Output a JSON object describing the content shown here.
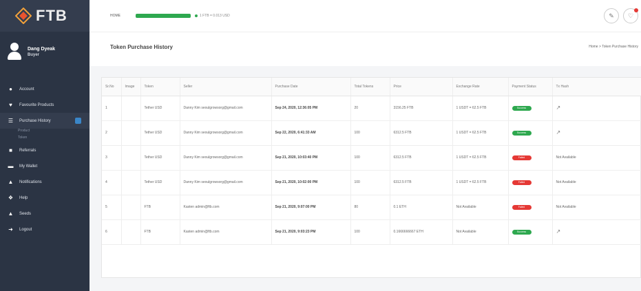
{
  "brand": {
    "logo_text": "FTB"
  },
  "profile": {
    "name": "Dang Dyeak",
    "role": "Buyer"
  },
  "sidebar": {
    "items": [
      {
        "label": "Account",
        "icon": "user-icon"
      },
      {
        "label": "Favourite Products",
        "icon": "heart-icon"
      },
      {
        "label": "Purchase History",
        "icon": "list-icon"
      },
      {
        "label": "Referrals",
        "icon": "people-icon"
      },
      {
        "label": "My Wallet",
        "icon": "wallet-icon"
      },
      {
        "label": "Notifications",
        "icon": "bell-icon"
      },
      {
        "label": "Help",
        "icon": "help-icon"
      },
      {
        "label": "Seeds",
        "icon": "seed-icon"
      },
      {
        "label": "Logout",
        "icon": "logout-icon"
      }
    ],
    "subitems": [
      "Product",
      "Token"
    ]
  },
  "topbar": {
    "home_label": "HOME",
    "rate_label": "1 FTB = 0.013 USD",
    "progress": 1.0
  },
  "page": {
    "title": "Token Purchase History",
    "breadcrumb": "Home  >  Token Purchase History"
  },
  "table": {
    "headers": [
      "Sr.No",
      "Image",
      "Token",
      "Seller",
      "Purchase Date",
      "Total Tokens",
      "Price",
      "Exchange Rate",
      "Payment Status",
      "Tx Hash"
    ],
    "rows": [
      {
        "sr": "1",
        "token": "Tether USD",
        "seller": "Danny Kim seoulgrowsorg@gmail.com",
        "date": "Sep 24, 2020, 12:36:05 PM",
        "total": "20",
        "price": "3156.25 FTB",
        "rate": "1 USDT = 62.5 FTB",
        "status": "Success",
        "status_type": "success",
        "hash": "link"
      },
      {
        "sr": "2",
        "token": "Tether USD",
        "seller": "Danny Kim seoulgrowsorg@gmail.com",
        "date": "Sep 22, 2020, 6:41:33 AM",
        "total": "100",
        "price": "6312.5 FTB",
        "rate": "1 USDT = 62.5 FTB",
        "status": "Success",
        "status_type": "success",
        "hash": "link"
      },
      {
        "sr": "3",
        "token": "Tether USD",
        "seller": "Danny Kim seoulgrowsorg@gmail.com",
        "date": "Sep 21, 2020, 10:03:40 PM",
        "total": "100",
        "price": "6312.5 FTB",
        "rate": "1 USDT = 62.5 FTB",
        "status": "Failed",
        "status_type": "failed",
        "hash": "Not Available"
      },
      {
        "sr": "4",
        "token": "Tether USD",
        "seller": "Danny Kim seoulgrowsorg@gmail.com",
        "date": "Sep 21, 2020, 10:02:00 PM",
        "total": "100",
        "price": "6312.5 FTB",
        "rate": "1 USDT = 62.5 FTB",
        "status": "Failed",
        "status_type": "failed",
        "hash": "Not Available"
      },
      {
        "sr": "5",
        "token": "FTB",
        "seller": "Kasten admin@ftb.com",
        "date": "Sep 21, 2020, 9:07:00 PM",
        "total": "80",
        "price": "0.1 ETH",
        "rate": "Not Available",
        "status": "Failed",
        "status_type": "failed",
        "hash": "Not Available"
      },
      {
        "sr": "6",
        "token": "FTB",
        "seller": "Kasten admin@ftb.com",
        "date": "Sep 21, 2020, 9:03:23 PM",
        "total": "100",
        "price": "0.1666666667 ETH",
        "rate": "Not Available",
        "status": "Success",
        "status_type": "success",
        "hash": "link"
      }
    ]
  }
}
